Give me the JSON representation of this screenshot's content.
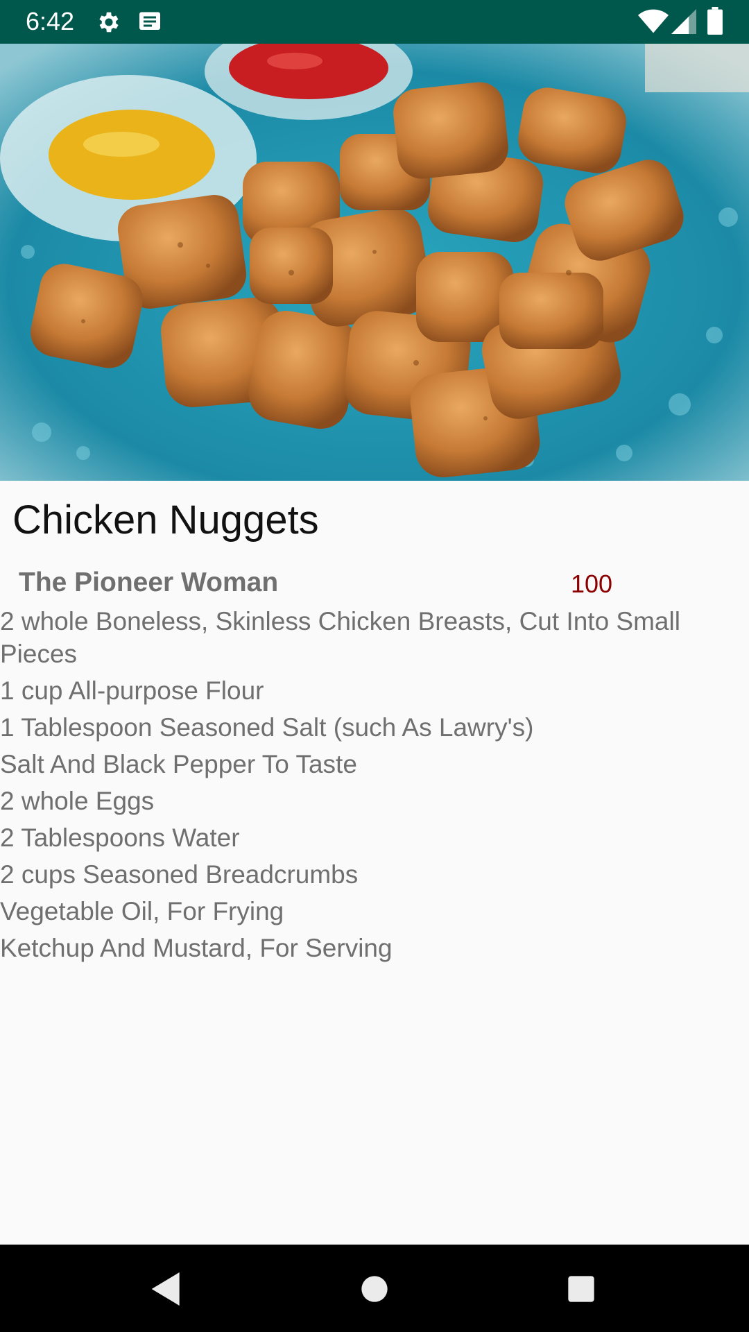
{
  "status_bar": {
    "time": "6:42",
    "icons": [
      "gear-icon",
      "message-icon",
      "wifi-icon",
      "signal-icon",
      "battery-icon"
    ]
  },
  "recipe": {
    "title": "Chicken Nuggets",
    "source": "The Pioneer Woman",
    "score": "100",
    "ingredients": [
      "2 whole Boneless, Skinless Chicken Breasts, Cut Into Small Pieces",
      "1 cup All-purpose Flour",
      "1 Tablespoon Seasoned Salt (such As Lawry's)",
      "Salt And Black Pepper To Taste",
      "2 whole Eggs",
      "2 Tablespoons Water",
      "2 cups Seasoned Breadcrumbs",
      "Vegetable Oil, For Frying",
      "Ketchup And Mustard, For Serving"
    ]
  },
  "colors": {
    "status_bar": "#00574b",
    "score": "#8b0000",
    "text_secondary": "#6f6f6f",
    "background": "#fafafa"
  },
  "nav_bar": {
    "icons": [
      "back-icon",
      "home-icon",
      "recents-icon"
    ]
  }
}
